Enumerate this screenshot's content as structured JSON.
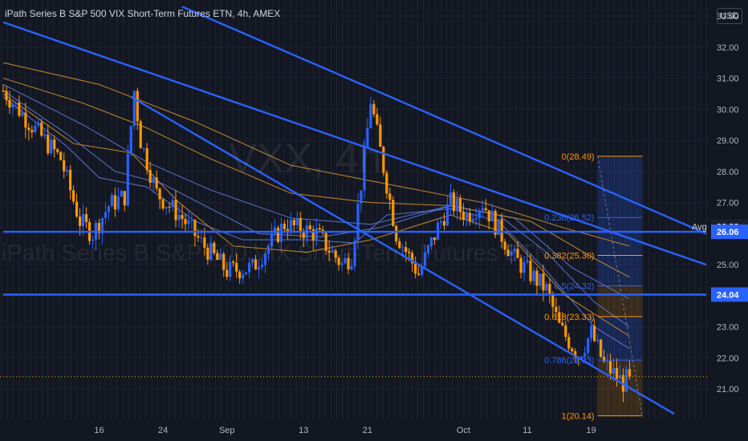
{
  "header": {
    "title": "iPath Series B S&P 500 VIX Short-Term Futures ETN, 4h, AMEX",
    "currency": "USD"
  },
  "watermark": {
    "ticker": "VXX, 4h",
    "name": "iPath Series B S&P 500 VIX Short-Term Futures ETN"
  },
  "colors": {
    "background": "#131722",
    "bull": "#2962ff",
    "bear": "#ff9800",
    "trendline": "#2962ff",
    "ma_blue": "#5b76d6",
    "ma_orange": "#c98a2c",
    "fib_orange": "#ff9800",
    "fib_blue": "#2962ff",
    "axis_text": "#b2b5be"
  },
  "chart_data": {
    "type": "candlestick",
    "title": "iPath Series B S&P 500 VIX Short-Term Futures ETN, 4h, AMEX",
    "y_axis": {
      "range": [
        20.0,
        33.0
      ],
      "ticks": [
        "33.00",
        "32.00",
        "31.00",
        "30.00",
        "29.00",
        "28.00",
        "27.00",
        "26.00",
        "25.00",
        "24.00",
        "23.00",
        "22.00",
        "21.00"
      ],
      "tick_values": [
        33,
        32,
        31,
        30,
        29,
        28,
        27,
        26,
        25,
        24,
        23,
        22,
        21
      ],
      "position": "right"
    },
    "x_axis": {
      "range_bars": [
        0,
        220
      ],
      "ticks": [
        {
          "label": "16",
          "bar": 30
        },
        {
          "label": "24",
          "bar": 50
        },
        {
          "label": "Sep",
          "bar": 70
        },
        {
          "label": "13",
          "bar": 94
        },
        {
          "label": "21",
          "bar": 114
        },
        {
          "label": "Oct",
          "bar": 144
        },
        {
          "label": "11",
          "bar": 164
        },
        {
          "label": "19",
          "bar": 184
        }
      ]
    },
    "grid": true,
    "series": [
      {
        "kind": "ohlc",
        "anchors": [
          [
            0,
            30.6
          ],
          [
            8,
            29.6
          ],
          [
            18,
            28.4
          ],
          [
            24,
            26.4
          ],
          [
            28,
            26.0
          ],
          [
            33,
            26.9
          ],
          [
            38,
            27.2
          ],
          [
            41,
            30.6
          ],
          [
            43,
            29.0
          ],
          [
            48,
            27.3
          ],
          [
            56,
            26.5
          ],
          [
            62,
            25.7
          ],
          [
            70,
            24.8
          ],
          [
            78,
            24.9
          ],
          [
            88,
            26.3
          ],
          [
            98,
            26.0
          ],
          [
            106,
            25.0
          ],
          [
            109,
            25.3
          ],
          [
            113,
            28.4
          ],
          [
            115,
            30.3
          ],
          [
            117,
            29.2
          ],
          [
            120,
            27.6
          ],
          [
            123,
            26.0
          ],
          [
            130,
            24.7
          ],
          [
            136,
            26.2
          ],
          [
            140,
            27.0
          ],
          [
            145,
            26.6
          ],
          [
            150,
            27.0
          ],
          [
            154,
            26.3
          ],
          [
            160,
            25.2
          ],
          [
            170,
            24.2
          ],
          [
            174,
            23.0
          ],
          [
            180,
            22.1
          ],
          [
            184,
            22.8
          ],
          [
            188,
            21.8
          ],
          [
            194,
            21.2
          ],
          [
            196,
            21.4
          ]
        ],
        "last_close": 21.4
      },
      {
        "name": "",
        "kind": "ma",
        "color": "blue",
        "points": [
          [
            0,
            30.4
          ],
          [
            20,
            28.8
          ],
          [
            30,
            27.8
          ],
          [
            45,
            27.5
          ],
          [
            60,
            26.4
          ],
          [
            75,
            25.8
          ],
          [
            95,
            25.8
          ],
          [
            110,
            25.7
          ],
          [
            120,
            26.6
          ],
          [
            140,
            26.8
          ],
          [
            155,
            26.4
          ],
          [
            170,
            24.8
          ],
          [
            185,
            23.0
          ],
          [
            196,
            22.3
          ]
        ]
      },
      {
        "name": "",
        "kind": "ma",
        "color": "blue",
        "points": [
          [
            0,
            30.6
          ],
          [
            20,
            29.2
          ],
          [
            35,
            28.0
          ],
          [
            50,
            27.6
          ],
          [
            65,
            26.8
          ],
          [
            80,
            26.0
          ],
          [
            100,
            25.9
          ],
          [
            118,
            26.2
          ],
          [
            140,
            26.9
          ],
          [
            155,
            26.6
          ],
          [
            170,
            25.4
          ],
          [
            185,
            23.8
          ],
          [
            196,
            23.0
          ]
        ]
      },
      {
        "name": "",
        "kind": "ma",
        "color": "blue",
        "points": [
          [
            0,
            30.8
          ],
          [
            25,
            29.5
          ],
          [
            45,
            28.3
          ],
          [
            65,
            27.4
          ],
          [
            90,
            26.5
          ],
          [
            115,
            26.3
          ],
          [
            140,
            26.9
          ],
          [
            160,
            26.5
          ],
          [
            178,
            24.9
          ],
          [
            196,
            23.9
          ]
        ]
      },
      {
        "name": "",
        "kind": "ma",
        "color": "orange",
        "points": [
          [
            0,
            30.5
          ],
          [
            22,
            28.9
          ],
          [
            40,
            28.6
          ],
          [
            55,
            27.0
          ],
          [
            72,
            25.6
          ],
          [
            95,
            25.4
          ],
          [
            115,
            25.8
          ],
          [
            140,
            26.6
          ],
          [
            158,
            26.0
          ],
          [
            176,
            24.0
          ],
          [
            196,
            22.7
          ]
        ]
      },
      {
        "name": "",
        "kind": "ma",
        "color": "orange",
        "points": [
          [
            0,
            31.0
          ],
          [
            25,
            30.2
          ],
          [
            45,
            29.4
          ],
          [
            65,
            28.4
          ],
          [
            90,
            27.3
          ],
          [
            115,
            27.0
          ],
          [
            140,
            26.9
          ],
          [
            165,
            26.4
          ],
          [
            185,
            25.2
          ],
          [
            196,
            24.6
          ]
        ]
      },
      {
        "name": "",
        "kind": "ma",
        "color": "orange",
        "points": [
          [
            0,
            31.5
          ],
          [
            30,
            30.8
          ],
          [
            60,
            29.6
          ],
          [
            90,
            28.2
          ],
          [
            120,
            27.6
          ],
          [
            150,
            27.0
          ],
          [
            175,
            26.2
          ],
          [
            196,
            25.6
          ]
        ]
      }
    ],
    "trendlines": [
      {
        "from": [
          0,
          32.8
        ],
        "to": [
          220,
          25.0
        ]
      },
      {
        "from": [
          56,
          33.3
        ],
        "to": [
          220,
          26.0
        ]
      },
      {
        "from": [
          40,
          30.4
        ],
        "to": [
          210,
          20.2
        ]
      },
      {
        "from": [
          0,
          26.06
        ],
        "to": [
          220,
          26.06
        ]
      },
      {
        "from": [
          0,
          24.04
        ],
        "to": [
          220,
          24.04
        ]
      }
    ],
    "fibonacci": {
      "from_bar": 186,
      "to_bar": 200,
      "levels": [
        {
          "ratio": "0",
          "value": 28.49,
          "label": "0(28.49)",
          "color": "orange"
        },
        {
          "ratio": "0.236",
          "value": 26.52,
          "label": "0.236(26.52)",
          "color": "blue"
        },
        {
          "ratio": "0.382",
          "value": 25.3,
          "label": "0.382(25.30)",
          "color": "orange"
        },
        {
          "ratio": "0.5",
          "value": 24.32,
          "label": "0.5(24.32)",
          "color": "blue"
        },
        {
          "ratio": "0.618",
          "value": 23.33,
          "label": "0.618(23.33)",
          "color": "orange"
        },
        {
          "ratio": "0.786",
          "value": 21.93,
          "label": "0.786(21.93)",
          "color": "blue"
        },
        {
          "ratio": "1",
          "value": 20.14,
          "label": "1(20.14)",
          "color": "orange"
        }
      ]
    },
    "price_labels": [
      {
        "text": "Avg",
        "value": 26.23,
        "style": "avg"
      },
      {
        "text": "26.23",
        "value": 26.23,
        "style": "avg"
      },
      {
        "text": "26.06",
        "value": 26.06,
        "style": "line"
      },
      {
        "text": "24.04",
        "value": 24.04,
        "style": "line"
      }
    ]
  }
}
